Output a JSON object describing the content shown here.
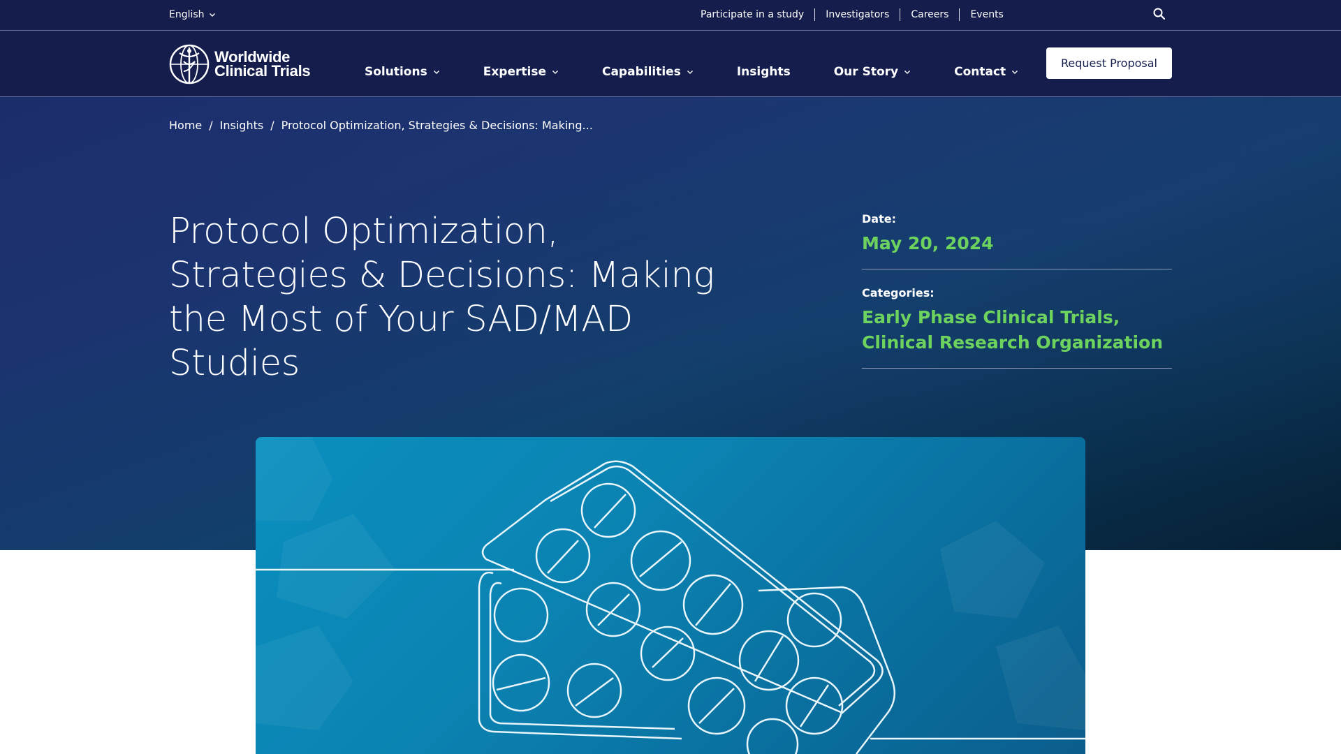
{
  "utility": {
    "language": "English",
    "links": [
      "Participate in a study",
      "Investigators",
      "Careers",
      "Events"
    ]
  },
  "brand": {
    "line1": "Worldwide",
    "line2": "Clinical Trials"
  },
  "nav": {
    "items": [
      {
        "label": "Solutions",
        "has_dropdown": true
      },
      {
        "label": "Expertise",
        "has_dropdown": true
      },
      {
        "label": "Capabilities",
        "has_dropdown": true
      },
      {
        "label": "Insights",
        "has_dropdown": false
      },
      {
        "label": "Our Story",
        "has_dropdown": true
      },
      {
        "label": "Contact",
        "has_dropdown": true
      }
    ],
    "cta": "Request Proposal"
  },
  "breadcrumb": {
    "home": "Home",
    "section": "Insights",
    "current": "Protocol Optimization, Strategies & Decisions: Making..."
  },
  "article": {
    "title": "Protocol Optimization, Strategies & Decisions: Making the Most of Your SAD/MAD Studies",
    "date_label": "Date:",
    "date": "May 20, 2024",
    "categories_label": "Categories:",
    "categories": "Early Phase Clinical Trials, Clinical Research Organization"
  },
  "colors": {
    "nav_bg": "#151d4d",
    "accent_green": "#6ed35e",
    "hero_blue": "#1b3470"
  },
  "icons": {
    "search": "search-icon",
    "chevron": "chevron-down-icon",
    "logo": "caduceus-globe-icon"
  }
}
